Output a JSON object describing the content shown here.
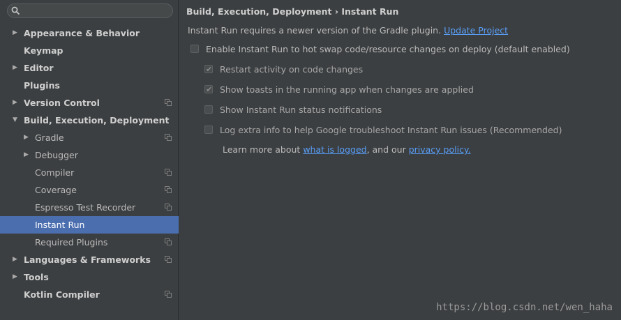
{
  "search": {
    "placeholder": ""
  },
  "sidebar": {
    "items": [
      {
        "label": "Appearance & Behavior",
        "bold": true,
        "arrow": "right",
        "indent": 0,
        "copy": false
      },
      {
        "label": "Keymap",
        "bold": true,
        "arrow": "",
        "indent": 0,
        "copy": false
      },
      {
        "label": "Editor",
        "bold": true,
        "arrow": "right",
        "indent": 0,
        "copy": false
      },
      {
        "label": "Plugins",
        "bold": true,
        "arrow": "",
        "indent": 0,
        "copy": false
      },
      {
        "label": "Version Control",
        "bold": true,
        "arrow": "right",
        "indent": 0,
        "copy": true
      },
      {
        "label": "Build, Execution, Deployment",
        "bold": true,
        "arrow": "down",
        "indent": 0,
        "copy": false
      },
      {
        "label": "Gradle",
        "bold": false,
        "arrow": "right",
        "indent": 1,
        "copy": true
      },
      {
        "label": "Debugger",
        "bold": false,
        "arrow": "right",
        "indent": 1,
        "copy": false
      },
      {
        "label": "Compiler",
        "bold": false,
        "arrow": "",
        "indent": 1,
        "copy": true
      },
      {
        "label": "Coverage",
        "bold": false,
        "arrow": "",
        "indent": 1,
        "copy": true
      },
      {
        "label": "Espresso Test Recorder",
        "bold": false,
        "arrow": "",
        "indent": 1,
        "copy": true
      },
      {
        "label": "Instant Run",
        "bold": false,
        "arrow": "",
        "indent": 1,
        "copy": false,
        "selected": true
      },
      {
        "label": "Required Plugins",
        "bold": false,
        "arrow": "",
        "indent": 1,
        "copy": true
      },
      {
        "label": "Languages & Frameworks",
        "bold": true,
        "arrow": "right",
        "indent": 0,
        "copy": true
      },
      {
        "label": "Tools",
        "bold": true,
        "arrow": "right",
        "indent": 0,
        "copy": false
      },
      {
        "label": "Kotlin Compiler",
        "bold": true,
        "arrow": "",
        "indent": 0,
        "copy": true
      }
    ]
  },
  "main": {
    "breadcrumb": {
      "parent": "Build, Execution, Deployment",
      "separator": "›",
      "current": "Instant Run"
    },
    "info_text": "Instant Run requires a newer version of the Gradle plugin.",
    "update_link": "Update Project",
    "options": [
      {
        "label": "Enable Instant Run to hot swap code/resource changes on deploy (default enabled)",
        "checked": false,
        "enabled": true
      },
      {
        "label": "Restart activity on code changes",
        "checked": true,
        "enabled": false
      },
      {
        "label": "Show toasts in the running app when changes are applied",
        "checked": true,
        "enabled": false
      },
      {
        "label": "Show Instant Run status notifications",
        "checked": false,
        "enabled": false
      },
      {
        "label": "Log extra info to help Google troubleshoot Instant Run issues (Recommended)",
        "checked": false,
        "enabled": false
      }
    ],
    "learn_more": {
      "prefix": "Learn more about ",
      "link1": "what is logged",
      "middle": ", and our ",
      "link2": "privacy policy."
    }
  },
  "watermark": "https://blog.csdn.net/wen_haha",
  "colors": {
    "selection": "#4b6eaf",
    "link": "#589df6",
    "background": "#3c3f41"
  }
}
